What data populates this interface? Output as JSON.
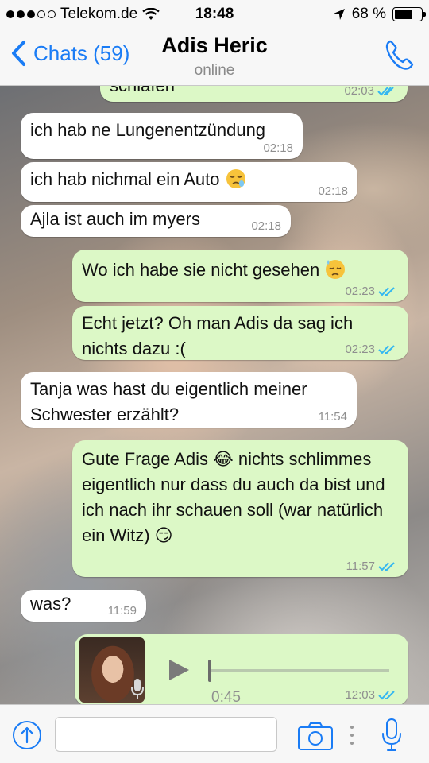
{
  "status_bar": {
    "carrier": "Telekom.de",
    "time": "18:48",
    "battery": "68 %",
    "battery_level": 0.68
  },
  "nav": {
    "back_label": "Chats (59)",
    "title": "Adis Heric",
    "subtitle": "online"
  },
  "messages": [
    {
      "text": "schlafen",
      "time": "02:03",
      "direction": "out"
    },
    {
      "text": "ich hab ne Lungenentzündung",
      "time": "02:18",
      "direction": "in"
    },
    {
      "text": "ich hab nichmal ein Auto",
      "time": "02:18",
      "direction": "in",
      "emoji": "😪"
    },
    {
      "text": "Ajla ist auch im myers",
      "time": "02:18",
      "direction": "in"
    },
    {
      "text": "Wo ich habe sie nicht gesehen",
      "time": "02:23",
      "direction": "out",
      "emoji": "😓"
    },
    {
      "text": "Echt jetzt? Oh man Adis da sag ich nichts dazu :(",
      "time": "02:23",
      "direction": "out"
    },
    {
      "text": "Tanja was hast du eigentlich meiner Schwester erzählt?",
      "time": "11:54",
      "direction": "in"
    },
    {
      "text": "Gute Frage Adis 😂 nichts schlimmes eigentlich nur dass du auch da bist und ich nach ihr schauen soll (war natürlich ein Witz) 😏",
      "time": "11:57",
      "direction": "out"
    },
    {
      "text": "was?",
      "time": "11:59",
      "direction": "in"
    },
    {
      "type": "voice",
      "duration": "0:45",
      "time": "12:03",
      "direction": "out"
    }
  ],
  "input": {
    "placeholder": ""
  },
  "colors": {
    "accent": "#1a7cf5",
    "outgoing_bubble": "#dcf8c6",
    "incoming_bubble": "#ffffff",
    "read_ticks": "#34b7f1"
  }
}
